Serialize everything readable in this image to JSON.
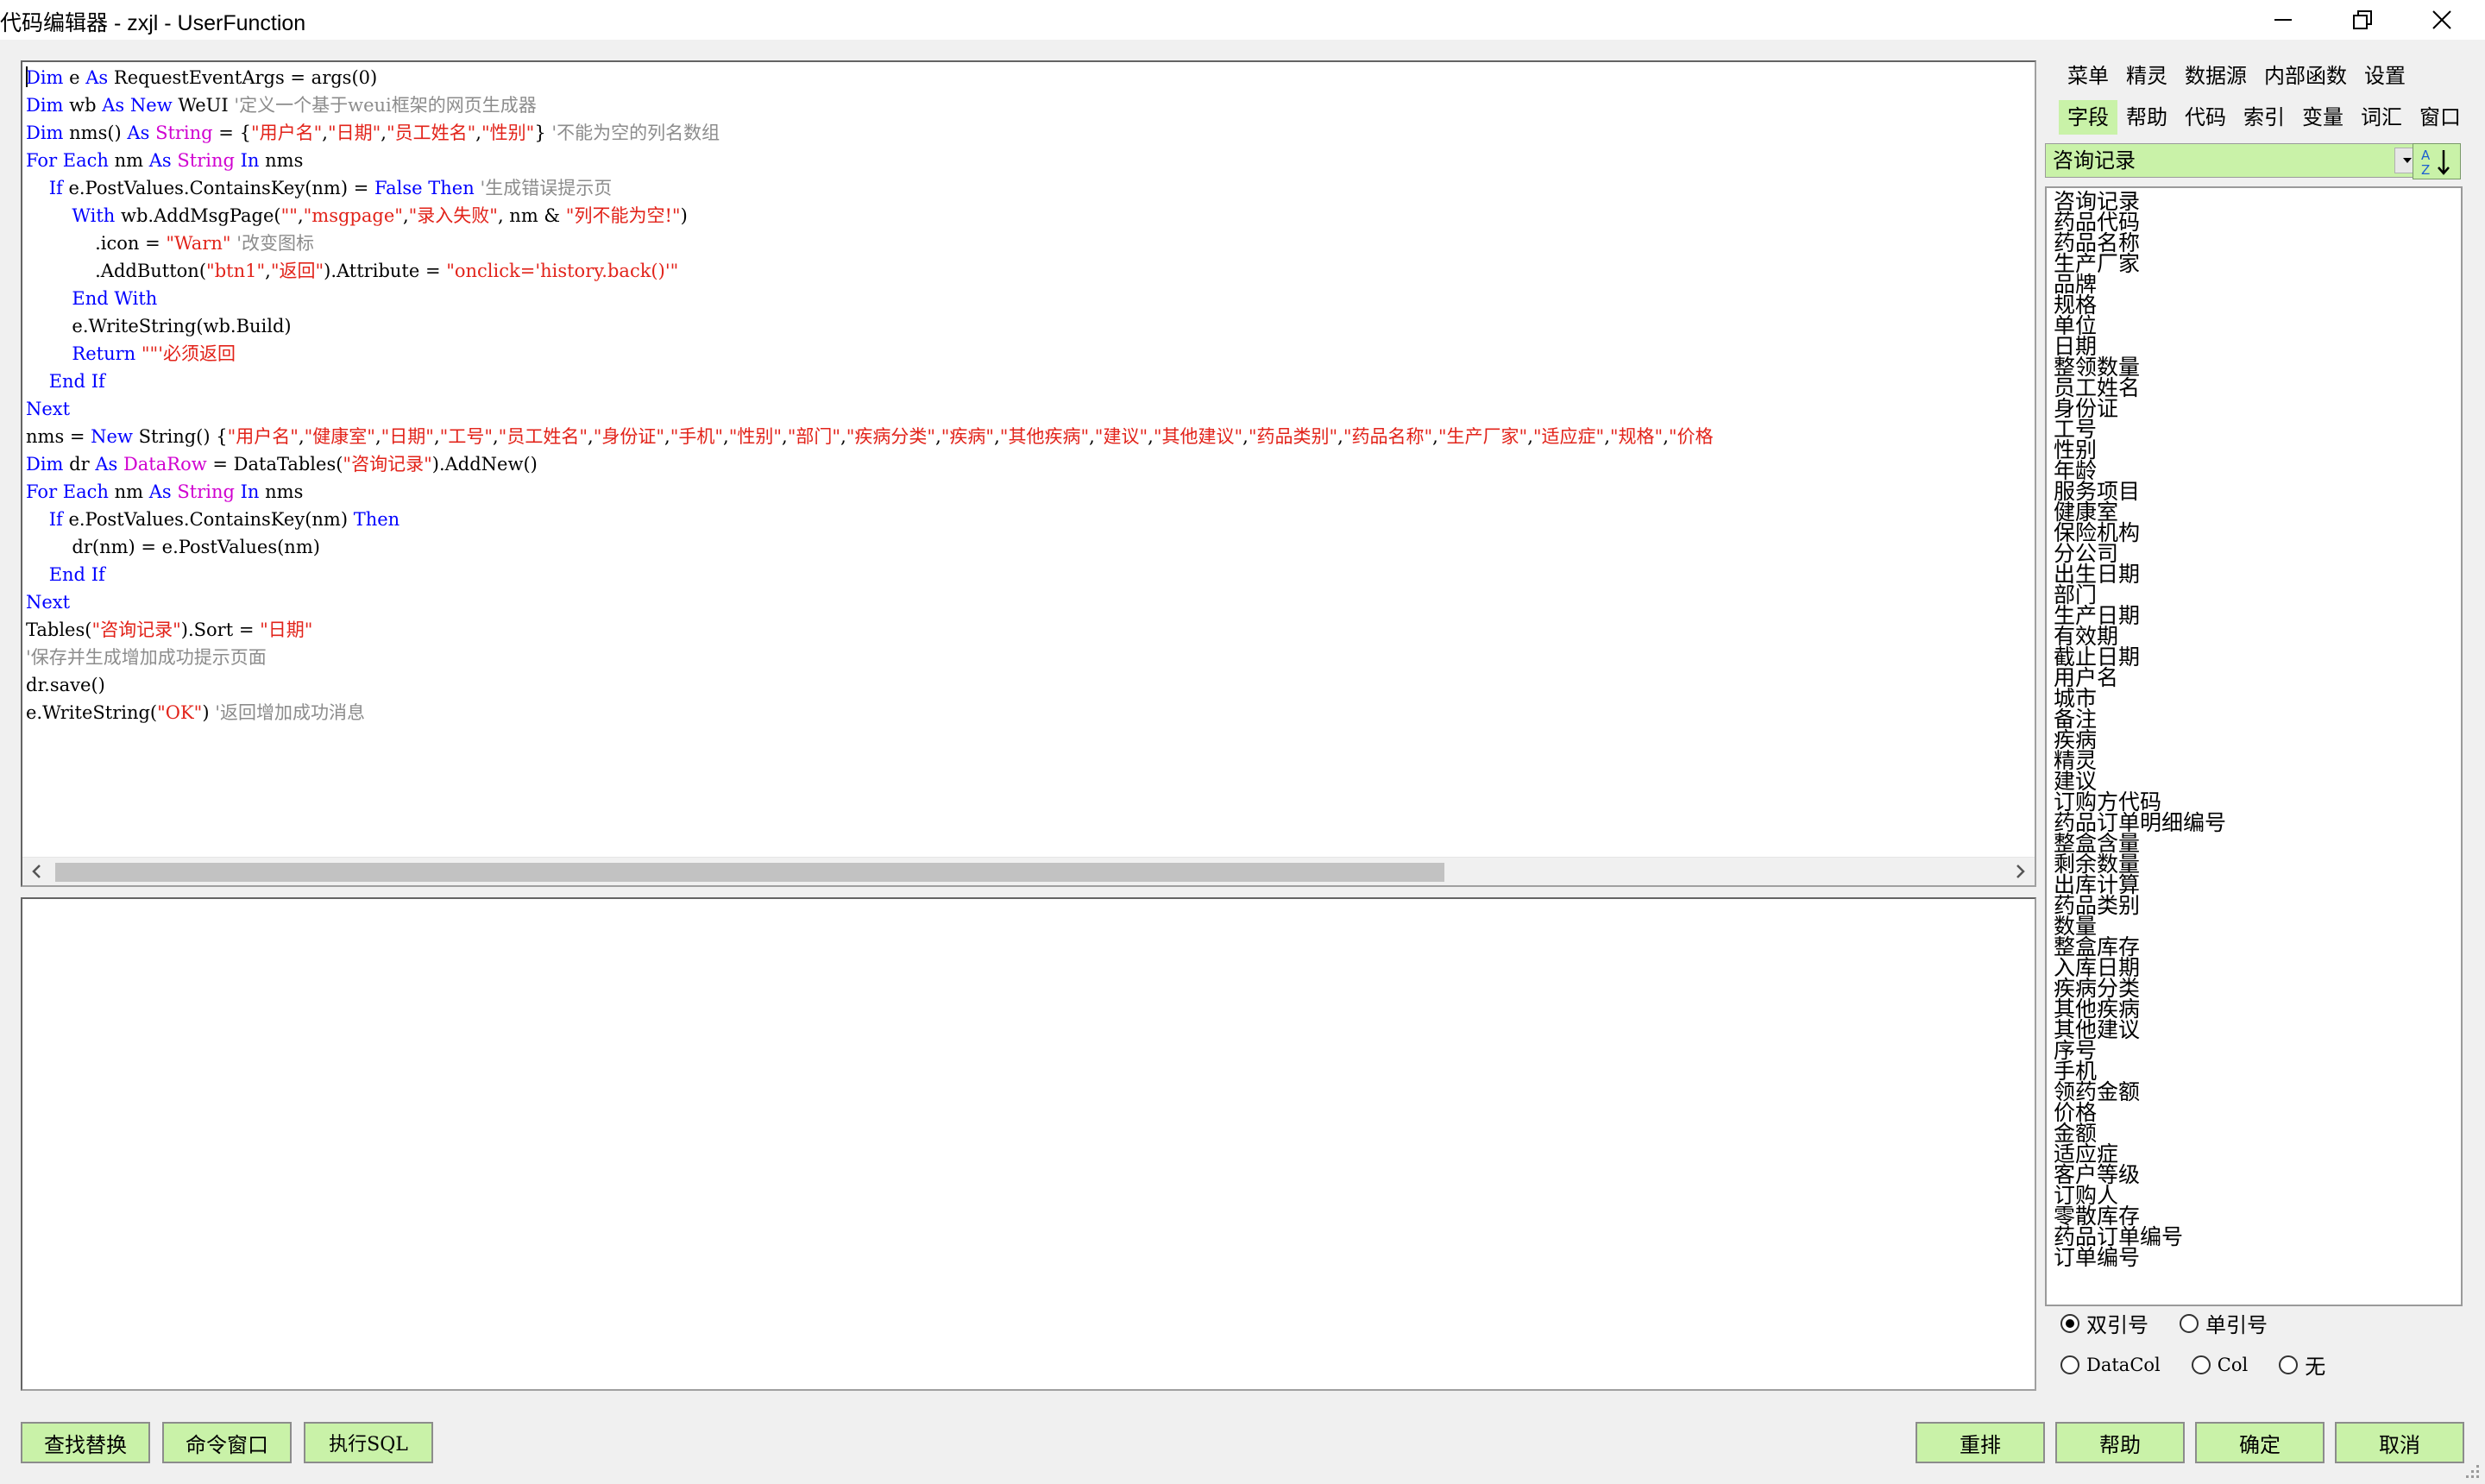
{
  "window": {
    "title": "代码编辑器 - zxjl - UserFunction",
    "controls": [
      "minimize",
      "restore",
      "close"
    ]
  },
  "editor": {
    "lines": [
      [
        {
          "t": "Dim",
          "c": "kw"
        },
        {
          "t": " e "
        },
        {
          "t": "As",
          "c": "kw"
        },
        {
          "t": " RequestEventArgs = args(0)"
        }
      ],
      [
        {
          "t": "Dim",
          "c": "kw"
        },
        {
          "t": " wb "
        },
        {
          "t": "As",
          "c": "kw"
        },
        {
          "t": " "
        },
        {
          "t": "New",
          "c": "kw"
        },
        {
          "t": " WeUI "
        },
        {
          "t": "'定义一个基于weui框架的网页生成器",
          "c": "cmt"
        }
      ],
      [
        {
          "t": "Dim",
          "c": "kw"
        },
        {
          "t": " nms() "
        },
        {
          "t": "As",
          "c": "kw"
        },
        {
          "t": " "
        },
        {
          "t": "String",
          "c": "ty"
        },
        {
          "t": " = {"
        },
        {
          "t": "\"用户名\"",
          "c": "str"
        },
        {
          "t": ","
        },
        {
          "t": "\"日期\"",
          "c": "str"
        },
        {
          "t": ","
        },
        {
          "t": "\"员工姓名\"",
          "c": "str"
        },
        {
          "t": ","
        },
        {
          "t": "\"性别\"",
          "c": "str"
        },
        {
          "t": "} "
        },
        {
          "t": "'不能为空的列名数组",
          "c": "cmt"
        }
      ],
      [
        {
          "t": "For",
          "c": "kw"
        },
        {
          "t": " "
        },
        {
          "t": "Each",
          "c": "kw"
        },
        {
          "t": " nm "
        },
        {
          "t": "As",
          "c": "kw"
        },
        {
          "t": " "
        },
        {
          "t": "String",
          "c": "ty"
        },
        {
          "t": " "
        },
        {
          "t": "In",
          "c": "kw"
        },
        {
          "t": " nms"
        }
      ],
      [
        {
          "t": "    "
        },
        {
          "t": "If",
          "c": "kw"
        },
        {
          "t": " e.PostValues.ContainsKey(nm) = "
        },
        {
          "t": "False",
          "c": "kw"
        },
        {
          "t": " "
        },
        {
          "t": "Then",
          "c": "kw"
        },
        {
          "t": " "
        },
        {
          "t": "'生成错误提示页",
          "c": "cmt"
        }
      ],
      [
        {
          "t": "        "
        },
        {
          "t": "With",
          "c": "kw"
        },
        {
          "t": " wb.AddMsgPage("
        },
        {
          "t": "\"\"",
          "c": "str"
        },
        {
          "t": ","
        },
        {
          "t": "\"msgpage\"",
          "c": "str"
        },
        {
          "t": ","
        },
        {
          "t": "\"录入失败\"",
          "c": "str"
        },
        {
          "t": ", nm & "
        },
        {
          "t": "\"列不能为空!\"",
          "c": "str"
        },
        {
          "t": ")"
        }
      ],
      [
        {
          "t": "            .icon = "
        },
        {
          "t": "\"Warn\"",
          "c": "str"
        },
        {
          "t": " "
        },
        {
          "t": "'改变图标",
          "c": "cmt"
        }
      ],
      [
        {
          "t": "            .AddButton("
        },
        {
          "t": "\"btn1\"",
          "c": "str"
        },
        {
          "t": ","
        },
        {
          "t": "\"返回\"",
          "c": "str"
        },
        {
          "t": ").Attribute = "
        },
        {
          "t": "\"onclick='history.back()'\"",
          "c": "str"
        }
      ],
      [
        {
          "t": "        "
        },
        {
          "t": "End",
          "c": "kw"
        },
        {
          "t": " "
        },
        {
          "t": "With",
          "c": "kw"
        }
      ],
      [
        {
          "t": "        e.WriteString(wb.Build)"
        }
      ],
      [
        {
          "t": "        "
        },
        {
          "t": "Return",
          "c": "kw"
        },
        {
          "t": " "
        },
        {
          "t": "\"\"",
          "c": "str"
        },
        {
          "t": "'必须返回",
          "c": "str"
        }
      ],
      [
        {
          "t": "    "
        },
        {
          "t": "End",
          "c": "kw"
        },
        {
          "t": " "
        },
        {
          "t": "If",
          "c": "kw"
        }
      ],
      [
        {
          "t": "Next",
          "c": "kw"
        }
      ],
      [
        {
          "t": "nms = "
        },
        {
          "t": "New",
          "c": "kw"
        },
        {
          "t": " String() {"
        },
        {
          "t": "\"用户名\"",
          "c": "str"
        },
        {
          "t": ","
        },
        {
          "t": "\"健康室\"",
          "c": "str"
        },
        {
          "t": ","
        },
        {
          "t": "\"日期\"",
          "c": "str"
        },
        {
          "t": ","
        },
        {
          "t": "\"工号\"",
          "c": "str"
        },
        {
          "t": ","
        },
        {
          "t": "\"员工姓名\"",
          "c": "str"
        },
        {
          "t": ","
        },
        {
          "t": "\"身份证\"",
          "c": "str"
        },
        {
          "t": ","
        },
        {
          "t": "\"手机\"",
          "c": "str"
        },
        {
          "t": ","
        },
        {
          "t": "\"性别\"",
          "c": "str"
        },
        {
          "t": ","
        },
        {
          "t": "\"部门\"",
          "c": "str"
        },
        {
          "t": ","
        },
        {
          "t": "\"疾病分类\"",
          "c": "str"
        },
        {
          "t": ","
        },
        {
          "t": "\"疾病\"",
          "c": "str"
        },
        {
          "t": ","
        },
        {
          "t": "\"其他疾病\"",
          "c": "str"
        },
        {
          "t": ","
        },
        {
          "t": "\"建议\"",
          "c": "str"
        },
        {
          "t": ","
        },
        {
          "t": "\"其他建议\"",
          "c": "str"
        },
        {
          "t": ","
        },
        {
          "t": "\"药品类别\"",
          "c": "str"
        },
        {
          "t": ","
        },
        {
          "t": "\"药品名称\"",
          "c": "str"
        },
        {
          "t": ","
        },
        {
          "t": "\"生产厂家\"",
          "c": "str"
        },
        {
          "t": ","
        },
        {
          "t": "\"适应症\"",
          "c": "str"
        },
        {
          "t": ","
        },
        {
          "t": "\"规格\"",
          "c": "str"
        },
        {
          "t": ","
        },
        {
          "t": "\"价格",
          "c": "str"
        }
      ],
      [
        {
          "t": "Dim",
          "c": "kw"
        },
        {
          "t": " dr "
        },
        {
          "t": "As",
          "c": "kw"
        },
        {
          "t": " "
        },
        {
          "t": "DataRow",
          "c": "ty"
        },
        {
          "t": " = DataTables("
        },
        {
          "t": "\"咨询记录\"",
          "c": "str"
        },
        {
          "t": ").AddNew()"
        }
      ],
      [
        {
          "t": "For",
          "c": "kw"
        },
        {
          "t": " "
        },
        {
          "t": "Each",
          "c": "kw"
        },
        {
          "t": " nm "
        },
        {
          "t": "As",
          "c": "kw"
        },
        {
          "t": " "
        },
        {
          "t": "String",
          "c": "ty"
        },
        {
          "t": " "
        },
        {
          "t": "In",
          "c": "kw"
        },
        {
          "t": " nms"
        }
      ],
      [
        {
          "t": "    "
        },
        {
          "t": "If",
          "c": "kw"
        },
        {
          "t": " e.PostValues.ContainsKey(nm) "
        },
        {
          "t": "Then",
          "c": "kw"
        }
      ],
      [
        {
          "t": "        dr(nm) = e.PostValues(nm)"
        }
      ],
      [
        {
          "t": "    "
        },
        {
          "t": "End",
          "c": "kw"
        },
        {
          "t": " "
        },
        {
          "t": "If",
          "c": "kw"
        }
      ],
      [
        {
          "t": "Next",
          "c": "kw"
        }
      ],
      [
        {
          "t": "Tables("
        },
        {
          "t": "\"咨询记录\"",
          "c": "str"
        },
        {
          "t": ").Sort = "
        },
        {
          "t": "\"日期\"",
          "c": "str"
        }
      ],
      [
        {
          "t": "'保存并生成增加成功提示页面",
          "c": "cmt"
        }
      ],
      [
        {
          "t": "dr.save()"
        }
      ],
      [
        {
          "t": "e.WriteString("
        },
        {
          "t": "\"OK\"",
          "c": "str"
        },
        {
          "t": ") "
        },
        {
          "t": "'返回增加成功消息",
          "c": "cmt"
        }
      ]
    ]
  },
  "panel": {
    "menu1": [
      "菜单",
      "精灵",
      "数据源",
      "内部函数",
      "设置"
    ],
    "menu2": [
      "字段",
      "帮助",
      "代码",
      "索引",
      "变量",
      "词汇",
      "窗口"
    ],
    "menu2_active": "字段",
    "table_select": "咨询记录",
    "fields": [
      "咨询记录",
      "药品代码",
      "药品名称",
      "生产厂家",
      "品牌",
      "规格",
      "单位",
      "日期",
      "整领数量",
      "员工姓名",
      "身份证",
      "工号",
      "性别",
      "年龄",
      "服务项目",
      "健康室",
      "保险机构",
      "分公司",
      "出生日期",
      "部门",
      "生产日期",
      "有效期",
      "截止日期",
      "用户名",
      "城市",
      "备注",
      "疾病",
      "精灵",
      "建议",
      "订购方代码",
      "药品订单明细编号",
      "整盒含量",
      "剩余数量",
      "出库计算",
      "药品类别",
      "数量",
      "整盒库存",
      "入库日期",
      "疾病分类",
      "其他疾病",
      "其他建议",
      "序号",
      "手机",
      "领药金额",
      "价格",
      "金额",
      "适应症",
      "客户等级",
      "订购人",
      "零散库存",
      "药品订单编号",
      "订单编号"
    ],
    "radios_row1": [
      {
        "label": "双引号",
        "checked": true
      },
      {
        "label": "单引号",
        "checked": false
      }
    ],
    "radios_row2": [
      {
        "label": "DataCol",
        "checked": false
      },
      {
        "label": "Col",
        "checked": false
      },
      {
        "label": "无",
        "checked": false
      }
    ]
  },
  "buttons": {
    "find_replace": "查找替换",
    "command_window": "命令窗口",
    "exec_sql": "执行SQL",
    "reformat": "重排",
    "help": "帮助",
    "ok": "确定",
    "cancel": "取消"
  },
  "colors": {
    "keyword": "#0000ff",
    "string": "#e2231a",
    "comment": "#8c8c8c",
    "type": "#d000d0",
    "button_bg": "#c9f2a8"
  }
}
